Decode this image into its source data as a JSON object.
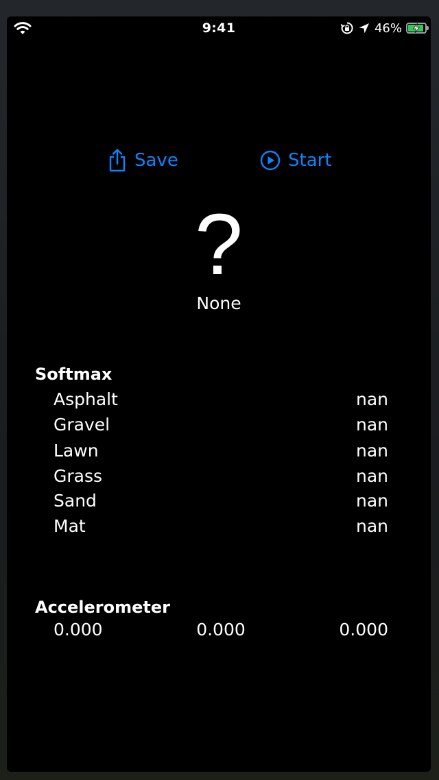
{
  "status_bar": {
    "time": "9:41",
    "battery_percent": "46%",
    "battery_level": 0.46,
    "icons": [
      "wifi-icon",
      "orientation-lock-icon",
      "location-arrow-icon",
      "battery-charging-icon"
    ]
  },
  "toolbar": {
    "save_label": "Save",
    "start_label": "Start",
    "accent_color": "#0a84ff"
  },
  "prediction": {
    "symbol": "?",
    "label": "None"
  },
  "softmax": {
    "heading": "Softmax",
    "rows": [
      {
        "name": "Asphalt",
        "value": "nan"
      },
      {
        "name": "Gravel",
        "value": "nan"
      },
      {
        "name": "Lawn",
        "value": "nan"
      },
      {
        "name": "Grass",
        "value": "nan"
      },
      {
        "name": "Sand",
        "value": "nan"
      },
      {
        "name": "Mat",
        "value": "nan"
      }
    ]
  },
  "accelerometer": {
    "heading": "Accelerometer",
    "x": "0.000",
    "y": "0.000",
    "z": "0.000"
  }
}
